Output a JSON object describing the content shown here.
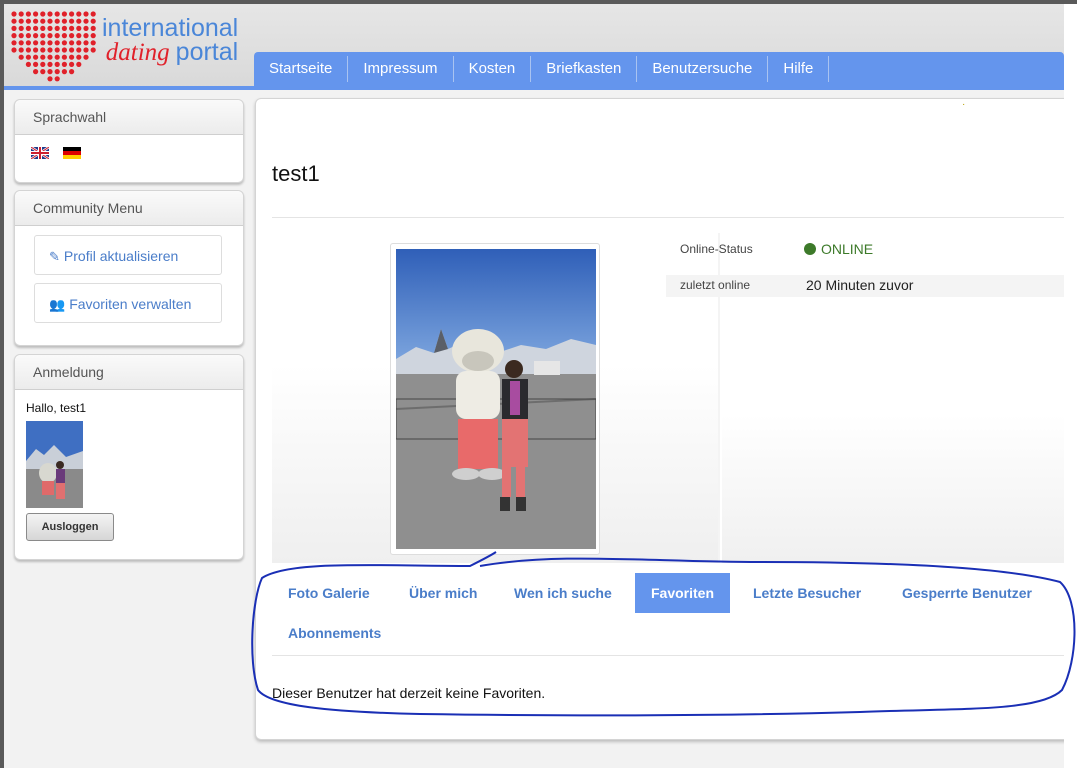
{
  "logo": {
    "line1": "international",
    "line2_italic": "dating",
    "line2_rest": "portal"
  },
  "nav": {
    "items": [
      "Startseite",
      "Impressum",
      "Kosten",
      "Briefkasten",
      "Benutzersuche",
      "Hilfe"
    ]
  },
  "sidebar": {
    "language": {
      "title": "Sprachwahl",
      "flags": [
        "uk-flag-icon",
        "german-flag-icon"
      ]
    },
    "community": {
      "title": "Community Menu",
      "items": [
        "Profil aktualisieren",
        "Favoriten verwalten"
      ]
    },
    "login": {
      "title": "Anmeldung",
      "greeting": "Hallo, test1",
      "logout_label": "Ausloggen"
    }
  },
  "profile": {
    "name": "test1",
    "online_status_label": "Online-Status",
    "online_status_value": "ONLINE",
    "last_online_label": "zuletzt online",
    "last_online_value": "20 Minuten zuvor"
  },
  "tabs": [
    "Foto Galerie",
    "Über mich",
    "Wen ich suche",
    "Favoriten",
    "Letzte Besucher",
    "Gesperrte Benutzer",
    "Abonnements"
  ],
  "active_tab": "Favoriten",
  "tab_content": "Dieser Benutzer hat derzeit keine Favoriten.",
  "colors": {
    "accent": "#6495ed",
    "link": "#4a7dc9",
    "online": "#3d7a2a",
    "annotation": "#1a2fb5"
  }
}
